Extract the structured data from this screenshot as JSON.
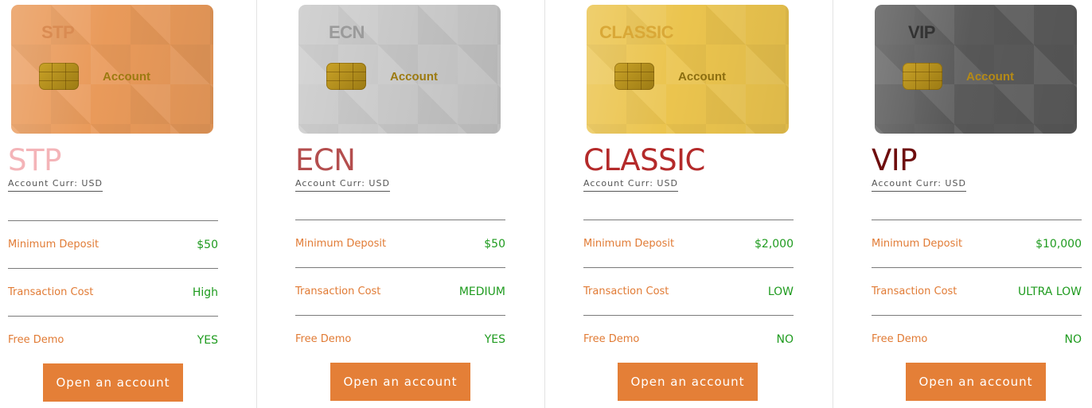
{
  "plans": [
    {
      "card_title": "STP",
      "card_account": "Account",
      "name": "STP",
      "currency": "Account Curr: USD",
      "rows": [
        {
          "label": "Minimum Deposit",
          "value": "$50"
        },
        {
          "label": "Transaction Cost",
          "value": "High"
        },
        {
          "label": "Free Demo",
          "value": "YES"
        }
      ],
      "button": "Open an account",
      "colors": {
        "card": "#e99a5a",
        "card_title": "#d98b52",
        "card_account": "#9c7a10",
        "name": "#f4b4b8"
      }
    },
    {
      "card_title": "ECN",
      "card_account": "Account",
      "name": "ECN",
      "currency": "Account Curr: USD",
      "rows": [
        {
          "label": "Minimum Deposit",
          "value": "$50"
        },
        {
          "label": "Transaction Cost",
          "value": "MEDIUM"
        },
        {
          "label": "Free Demo",
          "value": "YES"
        }
      ],
      "button": "Open an account",
      "colors": {
        "card": "#c8c8c8",
        "card_title": "#9a9a9a",
        "card_account": "#9c7a10",
        "name": "#b44e4e"
      }
    },
    {
      "card_title": "CLASSIC",
      "card_account": "Account",
      "name": "CLASSIC",
      "currency": "Account Curr: USD",
      "rows": [
        {
          "label": "Minimum Deposit",
          "value": "$2,000"
        },
        {
          "label": "Transaction Cost",
          "value": "LOW"
        },
        {
          "label": "Free Demo",
          "value": "NO"
        }
      ],
      "button": "Open an account",
      "colors": {
        "card": "#ebc44e",
        "card_title": "#d9a837",
        "card_account": "#8c6e10",
        "name": "#b42a2a"
      }
    },
    {
      "card_title": "VIP",
      "card_account": "Account",
      "name": "VIP",
      "currency": "Account Curr: USD",
      "rows": [
        {
          "label": "Minimum Deposit",
          "value": "$10,000"
        },
        {
          "label": "Transaction Cost",
          "value": "ULTRA LOW"
        },
        {
          "label": "Free Demo",
          "value": "NO"
        }
      ],
      "button": "Open an account",
      "colors": {
        "card": "#5a5a5a",
        "card_title": "#333333",
        "card_account": "#b58a16",
        "name": "#6e0d0d"
      }
    }
  ],
  "icons": [
    "card-chip-icon"
  ],
  "accent_color": "#e47f37",
  "value_color": "#1f9b1f",
  "label_color": "#e17b35"
}
